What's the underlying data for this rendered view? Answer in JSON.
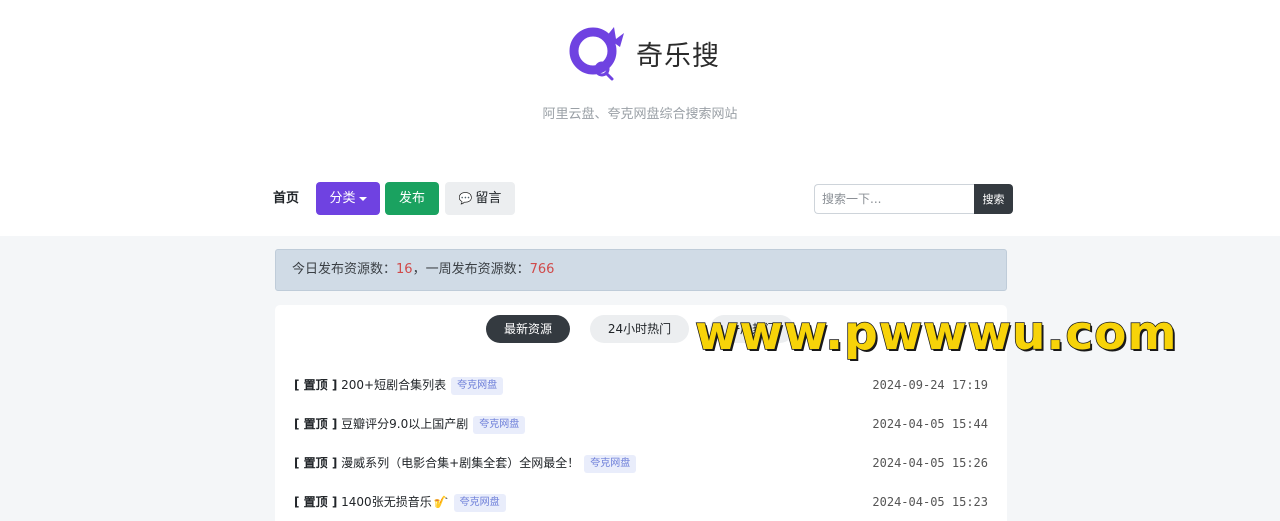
{
  "site": {
    "title": "奇乐搜",
    "subtitle": "阿里云盘、夸克网盘综合搜索网站",
    "brand_color": "#6f42e1"
  },
  "nav": {
    "home": "首页",
    "category": "分类",
    "publish": "发布",
    "message": "留言"
  },
  "search": {
    "placeholder": "搜索一下...",
    "button": "搜索"
  },
  "stats": {
    "today_label": "今日发布资源数：",
    "today_value": "16",
    "sep": "，",
    "week_label": "一周发布资源数：",
    "week_value": "766"
  },
  "tabs": {
    "latest": "最新资源",
    "hot24": "24小时热门",
    "week_hot": "一周热门"
  },
  "list": [
    {
      "pin": "[ 置顶 ]",
      "title": "200+短剧合集列表",
      "tag": "夸克网盘",
      "time": "2024-09-24 17:19"
    },
    {
      "pin": "[ 置顶 ]",
      "title": "豆瓣评分9.0以上国产剧",
      "tag": "夸克网盘",
      "time": "2024-04-05 15:44"
    },
    {
      "pin": "[ 置顶 ]",
      "title": "漫威系列（电影合集+剧集全套）全网最全！",
      "tag": "夸克网盘",
      "time": "2024-04-05 15:26"
    },
    {
      "pin": "[ 置顶 ]",
      "title": "1400张无损音乐",
      "tag": "夸克网盘",
      "time": "2024-04-05 15:23"
    }
  ],
  "watermark": "www.pwwwu.com"
}
